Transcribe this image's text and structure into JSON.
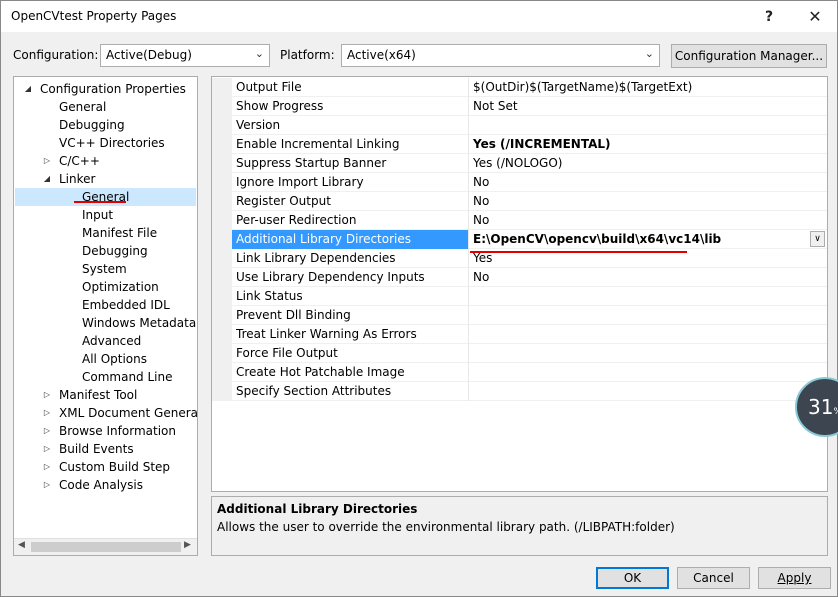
{
  "window": {
    "title": "OpenCVtest Property Pages",
    "help_label": "?",
    "close_label": "✕"
  },
  "config": {
    "configuration_label": "Configuration:",
    "configuration_value": "Active(Debug)",
    "platform_label": "Platform:",
    "platform_value": "Active(x64)",
    "manager_label": "Configuration Manager..."
  },
  "tree": [
    {
      "label": "Configuration Properties",
      "indent": 0,
      "toggle": "expanded"
    },
    {
      "label": "General",
      "indent": 1,
      "toggle": "none"
    },
    {
      "label": "Debugging",
      "indent": 1,
      "toggle": "none"
    },
    {
      "label": "VC++ Directories",
      "indent": 1,
      "toggle": "none"
    },
    {
      "label": "C/C++",
      "indent": 1,
      "toggle": "collapsed"
    },
    {
      "label": "Linker",
      "indent": 1,
      "toggle": "expanded"
    },
    {
      "label": "General",
      "indent": 2,
      "toggle": "none",
      "selected": true
    },
    {
      "label": "Input",
      "indent": 2,
      "toggle": "none"
    },
    {
      "label": "Manifest File",
      "indent": 2,
      "toggle": "none"
    },
    {
      "label": "Debugging",
      "indent": 2,
      "toggle": "none"
    },
    {
      "label": "System",
      "indent": 2,
      "toggle": "none"
    },
    {
      "label": "Optimization",
      "indent": 2,
      "toggle": "none"
    },
    {
      "label": "Embedded IDL",
      "indent": 2,
      "toggle": "none"
    },
    {
      "label": "Windows Metadata",
      "indent": 2,
      "toggle": "none"
    },
    {
      "label": "Advanced",
      "indent": 2,
      "toggle": "none"
    },
    {
      "label": "All Options",
      "indent": 2,
      "toggle": "none"
    },
    {
      "label": "Command Line",
      "indent": 2,
      "toggle": "none"
    },
    {
      "label": "Manifest Tool",
      "indent": 1,
      "toggle": "collapsed"
    },
    {
      "label": "XML Document Generator",
      "indent": 1,
      "toggle": "collapsed"
    },
    {
      "label": "Browse Information",
      "indent": 1,
      "toggle": "collapsed"
    },
    {
      "label": "Build Events",
      "indent": 1,
      "toggle": "collapsed"
    },
    {
      "label": "Custom Build Step",
      "indent": 1,
      "toggle": "collapsed"
    },
    {
      "label": "Code Analysis",
      "indent": 1,
      "toggle": "collapsed"
    }
  ],
  "properties": [
    {
      "name": "Output File",
      "value": "$(OutDir)$(TargetName)$(TargetExt)"
    },
    {
      "name": "Show Progress",
      "value": "Not Set"
    },
    {
      "name": "Version",
      "value": ""
    },
    {
      "name": "Enable Incremental Linking",
      "value": "Yes (/INCREMENTAL)",
      "bold": true
    },
    {
      "name": "Suppress Startup Banner",
      "value": "Yes (/NOLOGO)"
    },
    {
      "name": "Ignore Import Library",
      "value": "No"
    },
    {
      "name": "Register Output",
      "value": "No"
    },
    {
      "name": "Per-user Redirection",
      "value": "No"
    },
    {
      "name": "Additional Library Directories",
      "value": "E:\\OpenCV\\opencv\\build\\x64\\vc14\\lib",
      "bold": true,
      "selected": true
    },
    {
      "name": "Link Library Dependencies",
      "value": "Yes"
    },
    {
      "name": "Use Library Dependency Inputs",
      "value": "No"
    },
    {
      "name": "Link Status",
      "value": ""
    },
    {
      "name": "Prevent Dll Binding",
      "value": ""
    },
    {
      "name": "Treat Linker Warning As Errors",
      "value": ""
    },
    {
      "name": "Force File Output",
      "value": ""
    },
    {
      "name": "Create Hot Patchable Image",
      "value": ""
    },
    {
      "name": "Specify Section Attributes",
      "value": ""
    }
  ],
  "description": {
    "title": "Additional Library Directories",
    "text": "Allows the user to override the environmental library path. (/LIBPATH:folder)"
  },
  "buttons": {
    "ok": "OK",
    "cancel": "Cancel",
    "apply": "Apply"
  },
  "overlay": {
    "value": "31",
    "unit": "%"
  },
  "colors": {
    "selection": "#3399ff",
    "tree_selection": "#cce8ff",
    "annotation": "#e00000",
    "default_button": "#0078d7"
  }
}
